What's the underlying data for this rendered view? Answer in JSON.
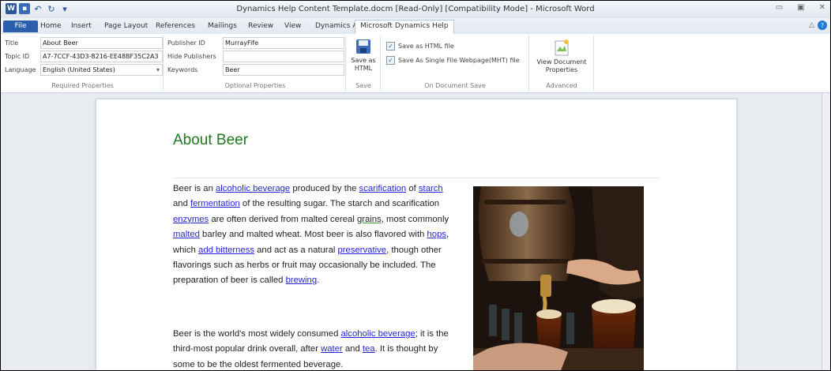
{
  "window": {
    "title": "Dynamics Help Content Template.docm [Read-Only] [Compatibility Mode] - Microsoft Word"
  },
  "qat": {
    "app_icon": "word-app-icon",
    "items": [
      "save-icon",
      "undo-icon",
      "redo-icon",
      "customize-qat-icon"
    ]
  },
  "tabs": [
    "File",
    "Home",
    "Insert",
    "Page Layout",
    "References",
    "Mailings",
    "Review",
    "View",
    "Dynamics AX",
    "Microsoft Dynamics Help"
  ],
  "ribbon": {
    "required": {
      "title_label": "Title",
      "title_value": "About Beer",
      "topic_label": "Topic ID",
      "topic_value": "A7-7CCF-43D3-8216-EE48BF35C2A3",
      "language_label": "Language",
      "language_value": "English (United States)",
      "group_label": "Required Properties"
    },
    "optional": {
      "publisher_label": "Publisher ID",
      "publisher_value": "MurrayFife",
      "hide_label": "Hide Publishers",
      "hide_value": "",
      "keywords_label": "Keywords",
      "keywords_value": "Beer",
      "group_label": "Optional Properties"
    },
    "save": {
      "button_line1": "Save as",
      "button_line2": "HTML",
      "group_label": "Save"
    },
    "ondoc": {
      "html_label": "Save as HTML file",
      "mht_label": "Save As Single File Webpage(MHT) file",
      "group_label": "On Document Save"
    },
    "advanced": {
      "button_line1": "View Document",
      "button_line2": "Properties",
      "group_label": "Advanced"
    }
  },
  "document": {
    "title": "About Beer",
    "p1": [
      {
        "t": "Beer is an "
      },
      {
        "t": "alcoholic beverage",
        "link": true
      },
      {
        "t": " produced by the "
      },
      {
        "t": "scarification",
        "link": true
      },
      {
        "t": " of "
      },
      {
        "t": "starch",
        "link": true
      },
      {
        "t": " and "
      },
      {
        "t": "fermentation",
        "link": true
      },
      {
        "t": " of the resulting sugar. The starch and scarification "
      },
      {
        "t": "enzymes",
        "link": true
      },
      {
        "t": " are often derived from malted cereal "
      },
      {
        "t": "grains",
        "grammar": true
      },
      {
        "t": ", most commonly "
      },
      {
        "t": "malted",
        "link": true
      },
      {
        "t": " barley and malted wheat.  Most beer is also flavored with "
      },
      {
        "t": "hops",
        "link": true
      },
      {
        "t": ", which "
      },
      {
        "t": "add bitterness",
        "link": true
      },
      {
        "t": " and act as a natural "
      },
      {
        "t": "preservative",
        "link": true
      },
      {
        "t": ", though other flavorings such as herbs or fruit may occasionally be included. The preparation of beer is called "
      },
      {
        "t": "brewing",
        "link": true
      },
      {
        "t": "."
      }
    ],
    "p2": [
      {
        "t": "Beer is the world's most widely consumed  "
      },
      {
        "t": "alcoholic beverage",
        "link": true
      },
      {
        "t": "; it is the third-most popular drink overall, after "
      },
      {
        "t": "water",
        "link": true
      },
      {
        "t": " and "
      },
      {
        "t": "tea",
        "link": true
      },
      {
        "t": ". It is thought by some to be the oldest fermented beverage."
      }
    ]
  }
}
